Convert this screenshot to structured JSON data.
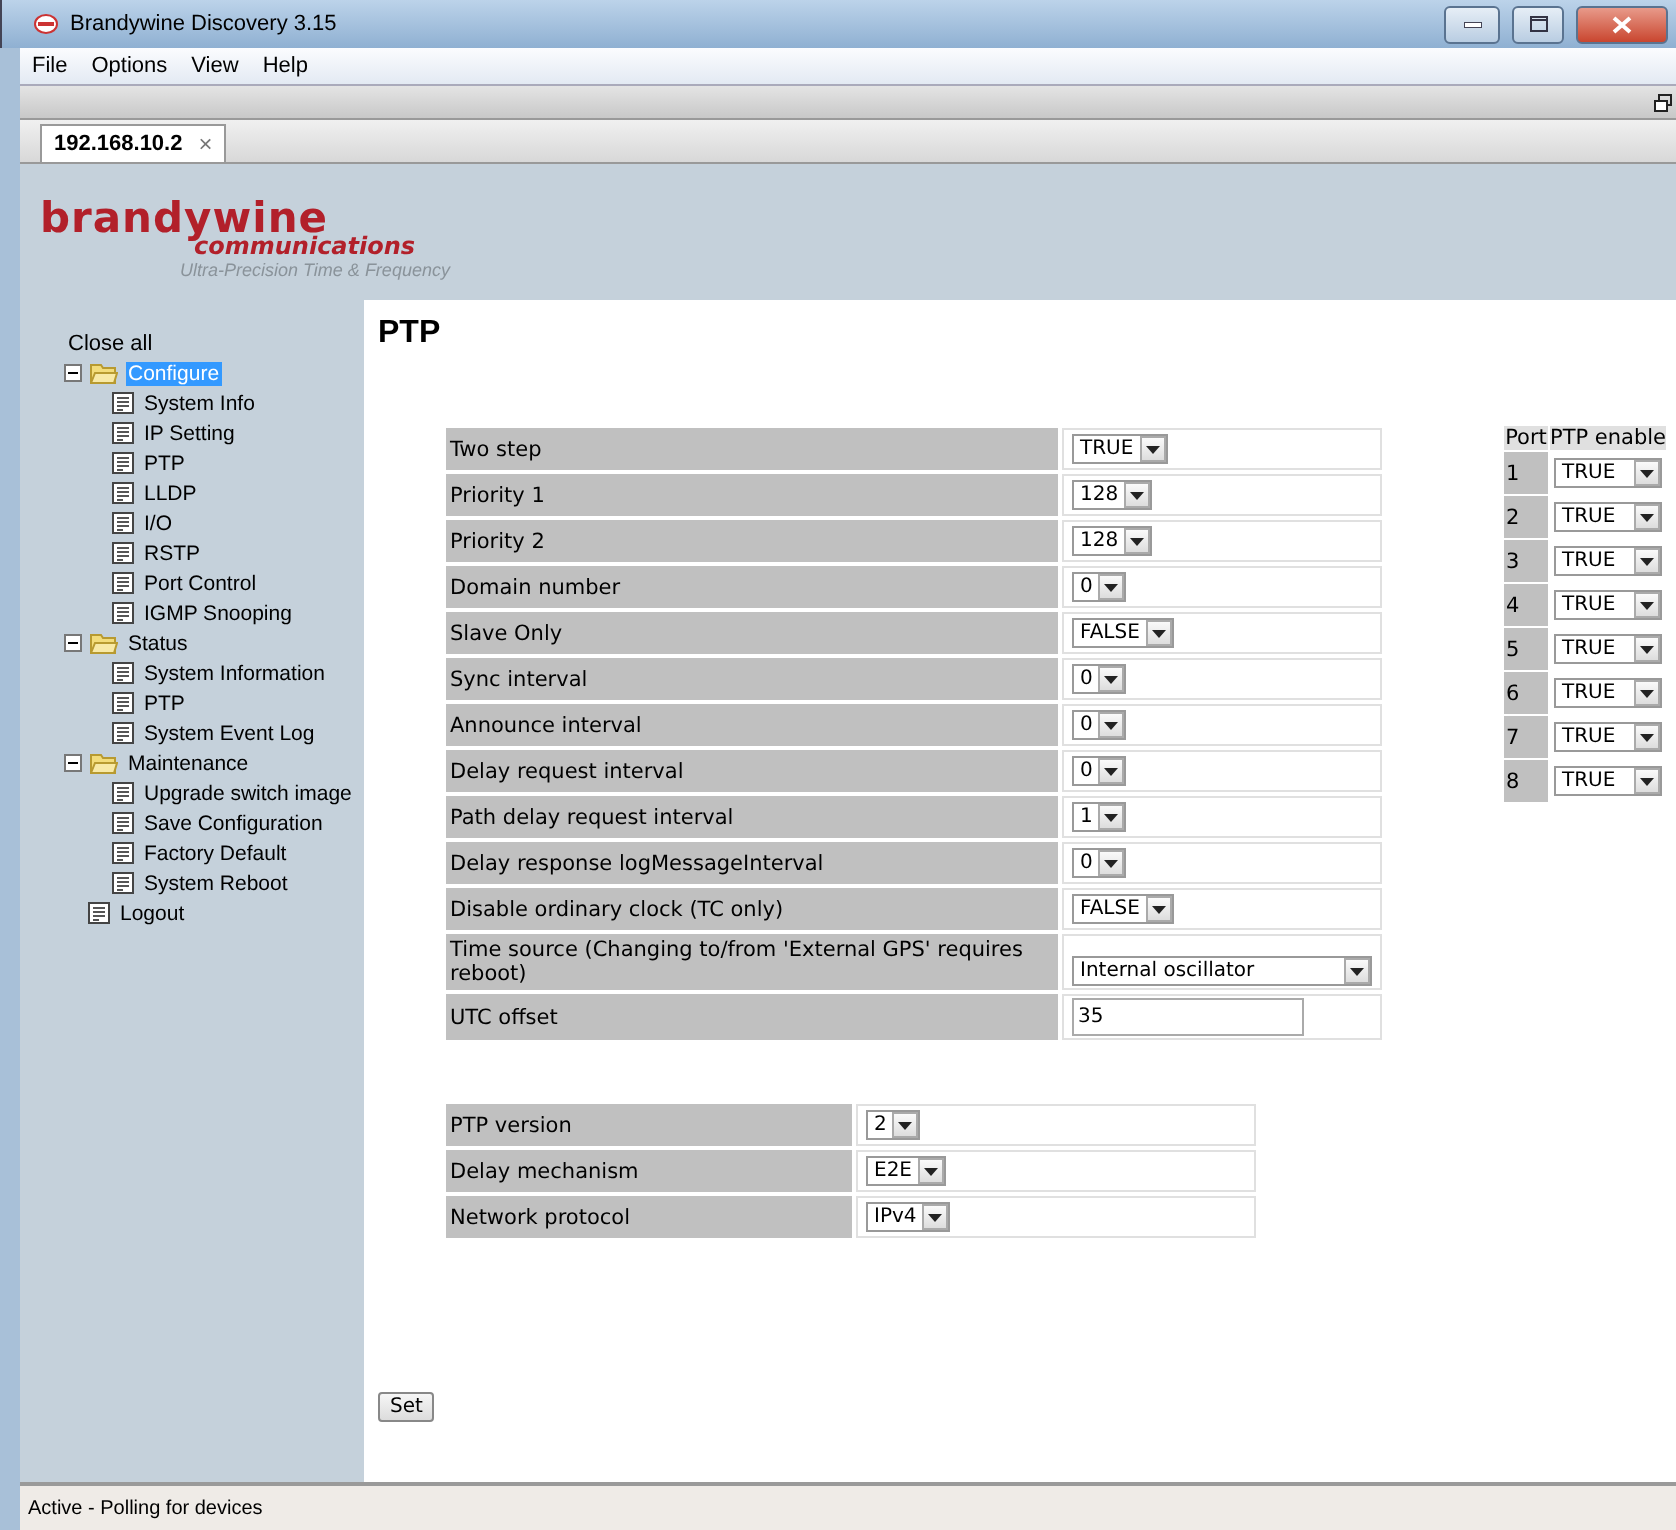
{
  "window": {
    "title": "Brandywine Discovery 3.15"
  },
  "menu": [
    "File",
    "Options",
    "View",
    "Help"
  ],
  "tabs": [
    {
      "label": "192.168.10.2",
      "selected": true,
      "close": "×"
    }
  ],
  "logo": {
    "name": "brandywine",
    "subtitle": "communications",
    "tagline": "Ultra-Precision Time & Frequency"
  },
  "sidebar": {
    "close_all": "Close all",
    "tree": [
      {
        "label": "Configure",
        "kind": "folder",
        "expanded": true,
        "selected": true,
        "children": [
          {
            "label": "System Info",
            "selected": false
          },
          {
            "label": "IP Setting",
            "selected": false
          },
          {
            "label": "PTP",
            "selected": false
          },
          {
            "label": "LLDP",
            "selected": false
          },
          {
            "label": "I/O",
            "selected": false
          },
          {
            "label": "RSTP",
            "selected": false
          },
          {
            "label": "Port Control",
            "selected": false
          },
          {
            "label": "IGMP Snooping",
            "selected": false
          }
        ]
      },
      {
        "label": "Status",
        "kind": "folder",
        "expanded": true,
        "selected": false,
        "children": [
          {
            "label": "System Information",
            "selected": false
          },
          {
            "label": "PTP",
            "selected": false
          },
          {
            "label": "System Event Log",
            "selected": false
          }
        ]
      },
      {
        "label": "Maintenance",
        "kind": "folder",
        "expanded": true,
        "selected": false,
        "children": [
          {
            "label": "Upgrade switch image",
            "selected": false
          },
          {
            "label": "Save Configuration",
            "selected": false
          },
          {
            "label": "Factory Default",
            "selected": false
          },
          {
            "label": "System Reboot",
            "selected": false
          }
        ]
      },
      {
        "label": "Logout",
        "kind": "page",
        "selected": false
      }
    ]
  },
  "page": {
    "title": "PTP",
    "settings": [
      {
        "label": "Two step",
        "kind": "select",
        "value": "TRUE"
      },
      {
        "label": "Priority 1",
        "kind": "select",
        "value": "128"
      },
      {
        "label": "Priority 2",
        "kind": "select",
        "value": "128"
      },
      {
        "label": "Domain number",
        "kind": "select",
        "value": "0"
      },
      {
        "label": "Slave Only",
        "kind": "select",
        "value": "FALSE"
      },
      {
        "label": "Sync interval",
        "kind": "select",
        "value": "0"
      },
      {
        "label": "Announce interval",
        "kind": "select",
        "value": "0"
      },
      {
        "label": "Delay request interval",
        "kind": "select",
        "value": "0"
      },
      {
        "label": "Path delay request interval",
        "kind": "select",
        "value": "1"
      },
      {
        "label": "Delay response logMessageInterval",
        "kind": "select",
        "value": "0"
      },
      {
        "label": "Disable ordinary clock (TC only)",
        "kind": "select",
        "value": "FALSE"
      },
      {
        "label": "Time source (Changing to/from 'External GPS' requires reboot)",
        "kind": "wide-select",
        "value": "Internal oscillator"
      },
      {
        "label": "UTC offset",
        "kind": "text",
        "value": "35"
      }
    ],
    "ports": {
      "columns": [
        "Port",
        "PTP enable"
      ],
      "rows": [
        {
          "port": "1",
          "value": "TRUE"
        },
        {
          "port": "2",
          "value": "TRUE"
        },
        {
          "port": "3",
          "value": "TRUE"
        },
        {
          "port": "4",
          "value": "TRUE"
        },
        {
          "port": "5",
          "value": "TRUE"
        },
        {
          "port": "6",
          "value": "TRUE"
        },
        {
          "port": "7",
          "value": "TRUE"
        },
        {
          "port": "8",
          "value": "TRUE"
        }
      ]
    },
    "protocol": [
      {
        "label": "PTP version",
        "kind": "select",
        "value": "2"
      },
      {
        "label": "Delay mechanism",
        "kind": "select",
        "value": "E2E"
      },
      {
        "label": "Network protocol",
        "kind": "select",
        "value": "IPv4"
      }
    ],
    "set_button": "Set"
  },
  "status_bar": "Active - Polling for devices"
}
